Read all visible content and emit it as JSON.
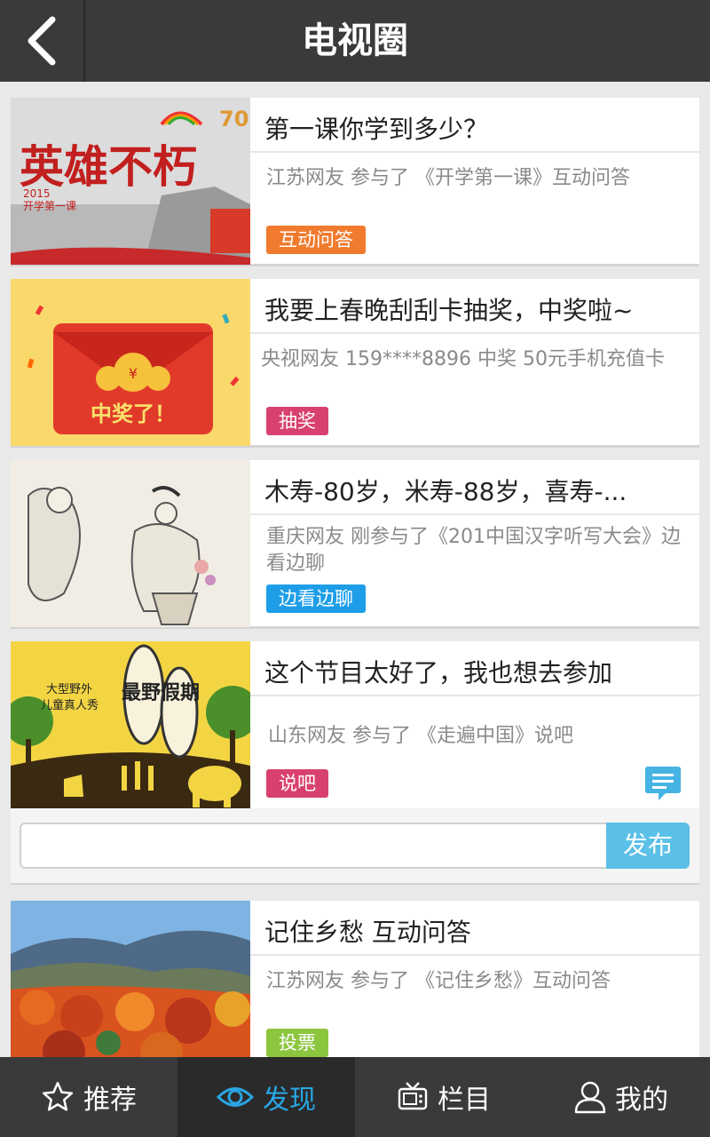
{
  "header": {
    "title": "电视圈",
    "back_icon": "chevron-left-icon"
  },
  "cards": [
    {
      "title": "第一课你学到多少？",
      "desc": "江苏网友 参与了 《开学第一课》互动问答",
      "tag": "互动问答",
      "tag_color": "#f07b2e",
      "thumb_text": "英雄不朽"
    },
    {
      "title": "我要上春晚刮刮卡抽奖，中奖啦~",
      "desc": "央视网友  159****8896   中奖   50元手机充值卡",
      "tag": "抽奖",
      "tag_color": "#d8416f",
      "thumb_text": "中奖了！"
    },
    {
      "title": "木寿-80岁，米寿-88岁，喜寿-...",
      "desc": "重庆网友 刚参与了《201中国汉字听写大会》边看边聊",
      "tag": "边看边聊",
      "tag_color": "#1e9ee8"
    },
    {
      "title": "这个节目太好了，我也想去参加",
      "desc": "山东网友    参与了 《走遍中国》说吧",
      "tag": "说吧",
      "tag_color": "#d8416f",
      "thumb_text": "最野假期",
      "thumb_sub": "大型野外\n儿童真人秀",
      "comment_placeholder": "",
      "publish_label": "发布"
    },
    {
      "title": "记住乡愁 互动问答",
      "desc": "江苏网友 参与了 《记住乡愁》互动问答",
      "tag": "投票",
      "tag_color": "#8cc63f"
    }
  ],
  "bottom_nav": [
    {
      "label": "推荐",
      "icon": "star-icon",
      "active": false
    },
    {
      "label": "发现",
      "icon": "eye-icon",
      "active": true
    },
    {
      "label": "栏目",
      "icon": "tv-icon",
      "active": false
    },
    {
      "label": "我的",
      "icon": "user-icon",
      "active": false
    }
  ]
}
